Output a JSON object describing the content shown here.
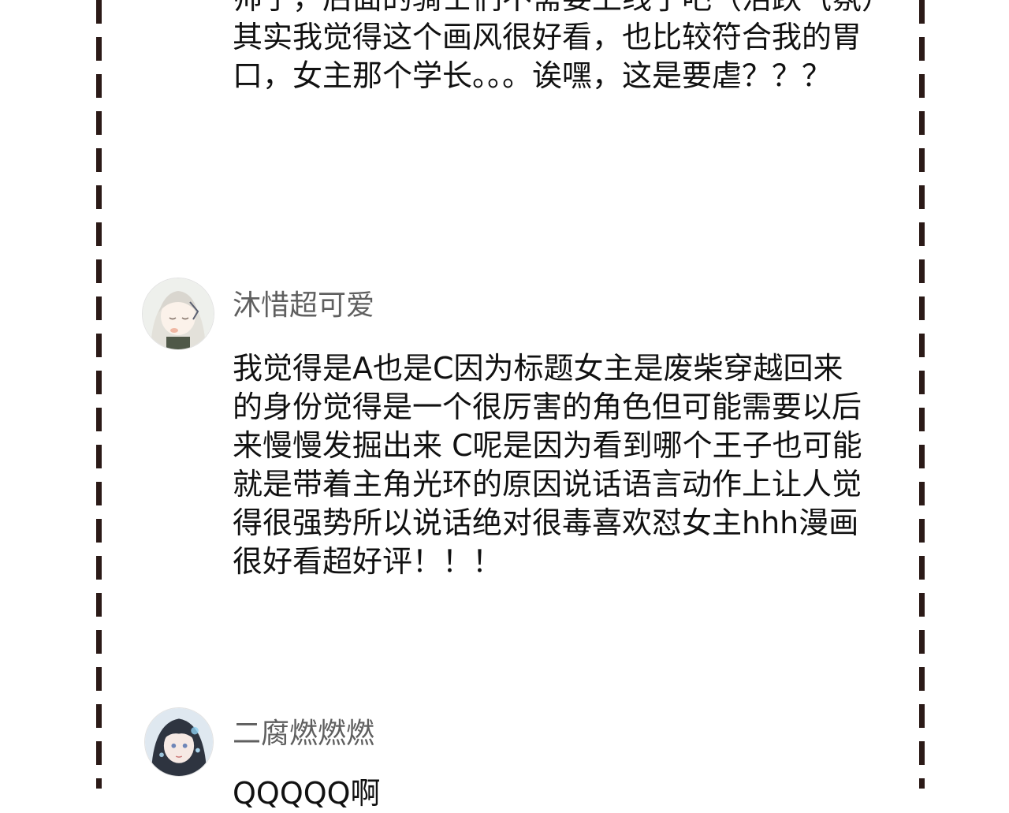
{
  "comments": [
    {
      "text": "帅子，后面的骑士们不需要上线了吧（活跃气氛）其实我觉得这个画风很好看，也比较符合我的胃口，女主那个学长。。。诶嘿，这是要虐？？？"
    },
    {
      "username": "沐惜超可爱",
      "avatar": "avatar-white-hair-girl",
      "text": "我觉得是A也是C因为标题女主是废柴穿越回来的身份觉得是一个很厉害的角色但可能需要以后来慢慢发掘出来 C呢是因为看到哪个王子也可能就是带着主角光环的原因说话语言动作上让人觉得很强势所以说话绝对很毒喜欢怼女主hhh漫画很好看超好评！！！"
    },
    {
      "username": "二腐燃燃燃",
      "avatar": "avatar-dark-hair-girl",
      "text": "QQQQQ啊"
    }
  ],
  "colors": {
    "border": "#2b1a17",
    "username": "#5f5f5f",
    "text": "#111111"
  }
}
